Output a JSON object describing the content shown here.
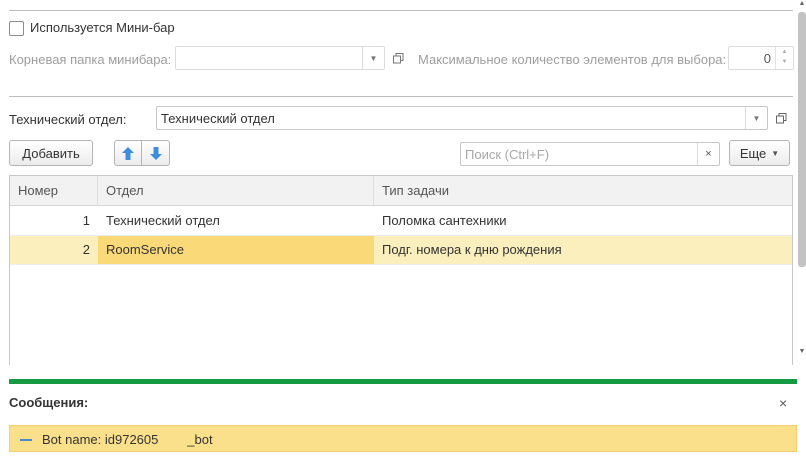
{
  "minibar": {
    "checkbox_label": "Используется Мини-бар",
    "checked": false,
    "root_folder_label": "Корневая папка минибара:",
    "root_folder_value": "",
    "max_items_label": "Максимальное количество элементов для выбора:",
    "max_items_value": "0"
  },
  "department": {
    "label": "Технический отдел:",
    "value": "Технический отдел"
  },
  "toolbar": {
    "add_label": "Добавить",
    "search_placeholder": "Поиск (Ctrl+F)",
    "clear_glyph": "×",
    "more_label": "Еще"
  },
  "table": {
    "columns": [
      "Номер",
      "Отдел",
      "Тип задачи"
    ],
    "rows": [
      {
        "num": "1",
        "dept": "Технический отдел",
        "task": "Поломка сантехники",
        "selected": false
      },
      {
        "num": "2",
        "dept": "RoomService",
        "task": "Подг. номера к дню рождения",
        "selected": true
      }
    ]
  },
  "messages": {
    "title": "Сообщения:",
    "close_glyph": "×",
    "items": [
      {
        "text": "Bot name: id972605        _bot"
      }
    ]
  },
  "colors": {
    "accent_green": "#169a44",
    "selected_row": "#fbefbe",
    "active_cell": "#f9d978",
    "message_bg": "#fbe08c",
    "arrow_blue": "#3d8ede"
  }
}
